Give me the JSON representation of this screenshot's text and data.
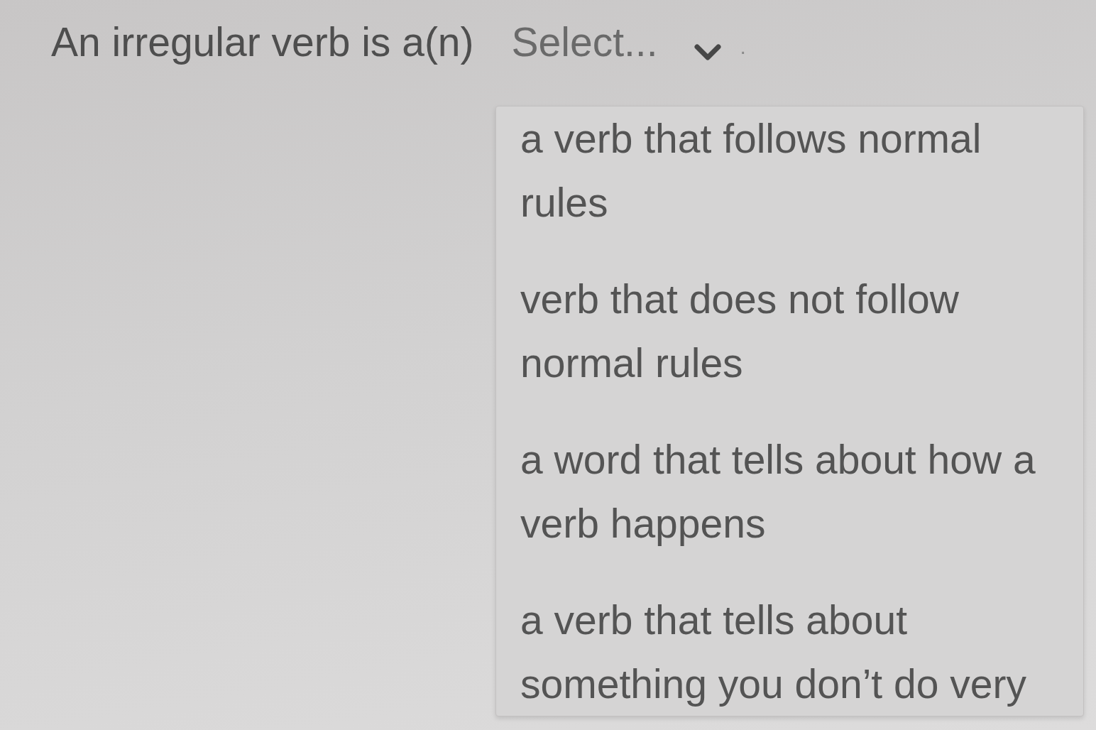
{
  "question": {
    "prompt": "An irregular verb is a(n)",
    "select": {
      "placeholder": "Select...",
      "expanded": true
    },
    "after": "."
  },
  "options": [
    {
      "label": "a verb that follows normal rules",
      "selected": false
    },
    {
      "label": "verb that does not follow normal rules",
      "selected": false
    },
    {
      "label": "a word that tells about how a verb happens",
      "selected": false
    },
    {
      "label": "a verb that tells about something you don’t do very",
      "selected": false
    }
  ]
}
